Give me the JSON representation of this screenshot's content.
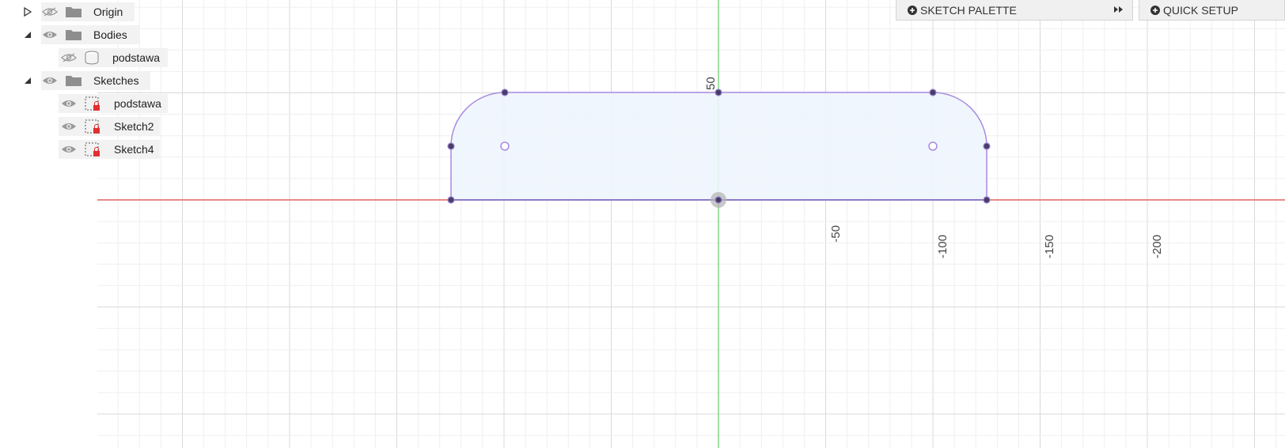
{
  "browser": {
    "items": [
      {
        "label": "Origin",
        "toggle": "collapsed",
        "visibility": "hidden",
        "icon": "folder-icon"
      },
      {
        "label": "Bodies",
        "toggle": "expanded",
        "visibility": "visible",
        "icon": "folder-icon"
      },
      {
        "label": "podstawa",
        "toggle": "none",
        "visibility": "hidden",
        "icon": "body-icon"
      },
      {
        "label": "Sketches",
        "toggle": "expanded",
        "visibility": "visible",
        "icon": "folder-icon"
      },
      {
        "label": "podstawa",
        "toggle": "none",
        "visibility": "visible",
        "icon": "sketch-icon"
      },
      {
        "label": "Sketch2",
        "toggle": "none",
        "visibility": "visible",
        "icon": "sketch-icon"
      },
      {
        "label": "Sketch4",
        "toggle": "none",
        "visibility": "visible",
        "icon": "sketch-icon"
      }
    ]
  },
  "toolbar": {
    "sketch_palette": "SKETCH PALETTE",
    "quick_setup": "QUICK SETUP"
  },
  "viewport": {
    "axis_labels": {
      "vertical": "50",
      "horizontal": [
        "-50",
        "-100",
        "-150",
        "-200"
      ]
    },
    "colors": {
      "x_axis": "#e88a8a",
      "y_axis": "#66cc66",
      "sketch_line": "#a88ae0",
      "profile_fill": "#eef5fd",
      "grid_major": "#d9d9d9",
      "grid_minor": "#efefef"
    }
  }
}
